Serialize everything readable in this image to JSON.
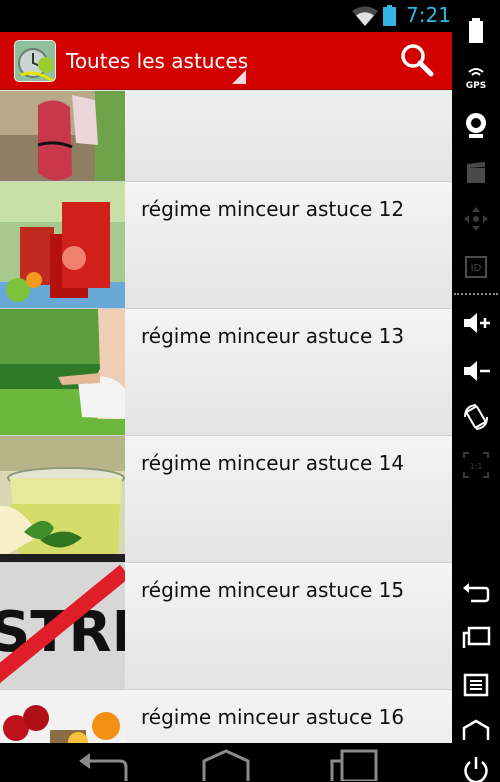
{
  "status_bar": {
    "time": "7:21"
  },
  "action_bar": {
    "title": "Toutes les astuces",
    "search_icon": "search-icon",
    "app_icon": "app-logo-icon"
  },
  "list": {
    "items": [
      {
        "label": "",
        "thumb": "running-shoes"
      },
      {
        "label": "régime minceur astuce 12",
        "thumb": "red-drinks"
      },
      {
        "label": "régime minceur astuce 13",
        "thumb": "yoga-grass"
      },
      {
        "label": "régime minceur astuce 14",
        "thumb": "green-tea"
      },
      {
        "label": "régime minceur astuce 15",
        "thumb": "no-stress-sign"
      },
      {
        "label": "régime minceur astuce 16",
        "thumb": "fruits"
      }
    ],
    "stress_text": "STRES"
  },
  "nav_bar": {
    "buttons": [
      "back-icon",
      "home-icon",
      "recent-apps-icon"
    ]
  },
  "side_panel": {
    "buttons": [
      "battery-icon",
      "gps-icon",
      "webcam-icon",
      "clapper-icon",
      "dpad-icon",
      "id-icon",
      "volume-up-icon",
      "volume-down-icon",
      "rotate-icon",
      "scale-icon",
      "back-icon",
      "recent-apps-icon",
      "menu-icon",
      "home-icon",
      "power-icon"
    ],
    "gps_label": "GPS",
    "id_label": "ID",
    "scale_label": "1:1"
  },
  "colors": {
    "action_bar": "#d20000",
    "status_accent": "#33b5e5",
    "list_bg": "#ececec"
  }
}
